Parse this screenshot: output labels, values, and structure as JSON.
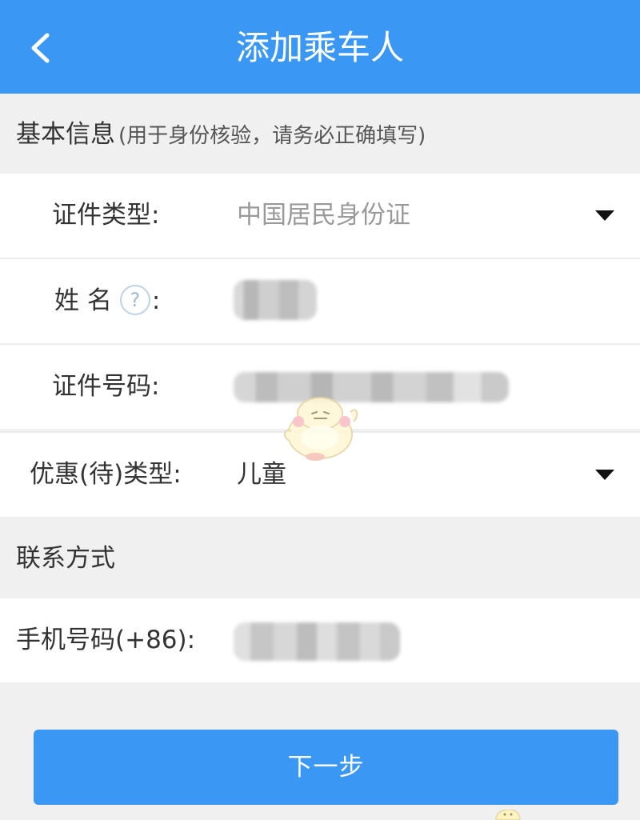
{
  "header": {
    "title": "添加乘车人"
  },
  "sections": {
    "basic_info": {
      "title": "基本信息",
      "subtitle": "(用于身份核验，请务必正确填写)"
    },
    "contact": {
      "title": "联系方式"
    }
  },
  "form": {
    "id_type": {
      "label": "证件类型:",
      "value": "中国居民身份证"
    },
    "name": {
      "label_prefix": "姓 名",
      "label_suffix": ":",
      "help_glyph": "?"
    },
    "id_number": {
      "label": "证件号码:"
    },
    "discount_type": {
      "label": "优惠(待)类型:",
      "value": "儿童"
    },
    "phone": {
      "label": "手机号码(+86):"
    }
  },
  "actions": {
    "next_label": "下一步"
  },
  "colors": {
    "brand_blue": "#3a97f4",
    "page_bg": "#f0f0f0",
    "placeholder_gray": "#999999"
  },
  "icons": {
    "back": "chevron-left-icon",
    "dropdown": "caret-down-icon",
    "help": "question-circle-icon"
  }
}
